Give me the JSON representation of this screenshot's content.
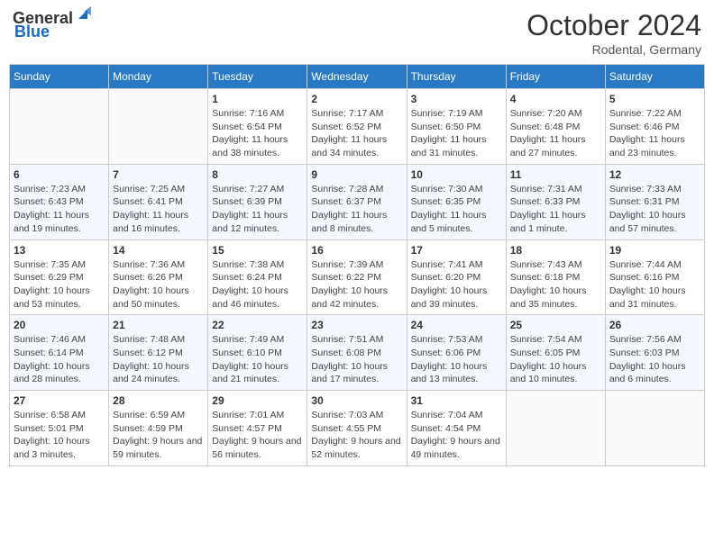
{
  "header": {
    "logo_general": "General",
    "logo_blue": "Blue",
    "month_title": "October 2024",
    "location": "Rodental, Germany"
  },
  "days_of_week": [
    "Sunday",
    "Monday",
    "Tuesday",
    "Wednesday",
    "Thursday",
    "Friday",
    "Saturday"
  ],
  "weeks": [
    {
      "days": [
        {
          "num": "",
          "info": ""
        },
        {
          "num": "",
          "info": ""
        },
        {
          "num": "1",
          "info": "Sunrise: 7:16 AM\nSunset: 6:54 PM\nDaylight: 11 hours and 38 minutes."
        },
        {
          "num": "2",
          "info": "Sunrise: 7:17 AM\nSunset: 6:52 PM\nDaylight: 11 hours and 34 minutes."
        },
        {
          "num": "3",
          "info": "Sunrise: 7:19 AM\nSunset: 6:50 PM\nDaylight: 11 hours and 31 minutes."
        },
        {
          "num": "4",
          "info": "Sunrise: 7:20 AM\nSunset: 6:48 PM\nDaylight: 11 hours and 27 minutes."
        },
        {
          "num": "5",
          "info": "Sunrise: 7:22 AM\nSunset: 6:46 PM\nDaylight: 11 hours and 23 minutes."
        }
      ]
    },
    {
      "days": [
        {
          "num": "6",
          "info": "Sunrise: 7:23 AM\nSunset: 6:43 PM\nDaylight: 11 hours and 19 minutes."
        },
        {
          "num": "7",
          "info": "Sunrise: 7:25 AM\nSunset: 6:41 PM\nDaylight: 11 hours and 16 minutes."
        },
        {
          "num": "8",
          "info": "Sunrise: 7:27 AM\nSunset: 6:39 PM\nDaylight: 11 hours and 12 minutes."
        },
        {
          "num": "9",
          "info": "Sunrise: 7:28 AM\nSunset: 6:37 PM\nDaylight: 11 hours and 8 minutes."
        },
        {
          "num": "10",
          "info": "Sunrise: 7:30 AM\nSunset: 6:35 PM\nDaylight: 11 hours and 5 minutes."
        },
        {
          "num": "11",
          "info": "Sunrise: 7:31 AM\nSunset: 6:33 PM\nDaylight: 11 hours and 1 minute."
        },
        {
          "num": "12",
          "info": "Sunrise: 7:33 AM\nSunset: 6:31 PM\nDaylight: 10 hours and 57 minutes."
        }
      ]
    },
    {
      "days": [
        {
          "num": "13",
          "info": "Sunrise: 7:35 AM\nSunset: 6:29 PM\nDaylight: 10 hours and 53 minutes."
        },
        {
          "num": "14",
          "info": "Sunrise: 7:36 AM\nSunset: 6:26 PM\nDaylight: 10 hours and 50 minutes."
        },
        {
          "num": "15",
          "info": "Sunrise: 7:38 AM\nSunset: 6:24 PM\nDaylight: 10 hours and 46 minutes."
        },
        {
          "num": "16",
          "info": "Sunrise: 7:39 AM\nSunset: 6:22 PM\nDaylight: 10 hours and 42 minutes."
        },
        {
          "num": "17",
          "info": "Sunrise: 7:41 AM\nSunset: 6:20 PM\nDaylight: 10 hours and 39 minutes."
        },
        {
          "num": "18",
          "info": "Sunrise: 7:43 AM\nSunset: 6:18 PM\nDaylight: 10 hours and 35 minutes."
        },
        {
          "num": "19",
          "info": "Sunrise: 7:44 AM\nSunset: 6:16 PM\nDaylight: 10 hours and 31 minutes."
        }
      ]
    },
    {
      "days": [
        {
          "num": "20",
          "info": "Sunrise: 7:46 AM\nSunset: 6:14 PM\nDaylight: 10 hours and 28 minutes."
        },
        {
          "num": "21",
          "info": "Sunrise: 7:48 AM\nSunset: 6:12 PM\nDaylight: 10 hours and 24 minutes."
        },
        {
          "num": "22",
          "info": "Sunrise: 7:49 AM\nSunset: 6:10 PM\nDaylight: 10 hours and 21 minutes."
        },
        {
          "num": "23",
          "info": "Sunrise: 7:51 AM\nSunset: 6:08 PM\nDaylight: 10 hours and 17 minutes."
        },
        {
          "num": "24",
          "info": "Sunrise: 7:53 AM\nSunset: 6:06 PM\nDaylight: 10 hours and 13 minutes."
        },
        {
          "num": "25",
          "info": "Sunrise: 7:54 AM\nSunset: 6:05 PM\nDaylight: 10 hours and 10 minutes."
        },
        {
          "num": "26",
          "info": "Sunrise: 7:56 AM\nSunset: 6:03 PM\nDaylight: 10 hours and 6 minutes."
        }
      ]
    },
    {
      "days": [
        {
          "num": "27",
          "info": "Sunrise: 6:58 AM\nSunset: 5:01 PM\nDaylight: 10 hours and 3 minutes."
        },
        {
          "num": "28",
          "info": "Sunrise: 6:59 AM\nSunset: 4:59 PM\nDaylight: 9 hours and 59 minutes."
        },
        {
          "num": "29",
          "info": "Sunrise: 7:01 AM\nSunset: 4:57 PM\nDaylight: 9 hours and 56 minutes."
        },
        {
          "num": "30",
          "info": "Sunrise: 7:03 AM\nSunset: 4:55 PM\nDaylight: 9 hours and 52 minutes."
        },
        {
          "num": "31",
          "info": "Sunrise: 7:04 AM\nSunset: 4:54 PM\nDaylight: 9 hours and 49 minutes."
        },
        {
          "num": "",
          "info": ""
        },
        {
          "num": "",
          "info": ""
        }
      ]
    }
  ]
}
